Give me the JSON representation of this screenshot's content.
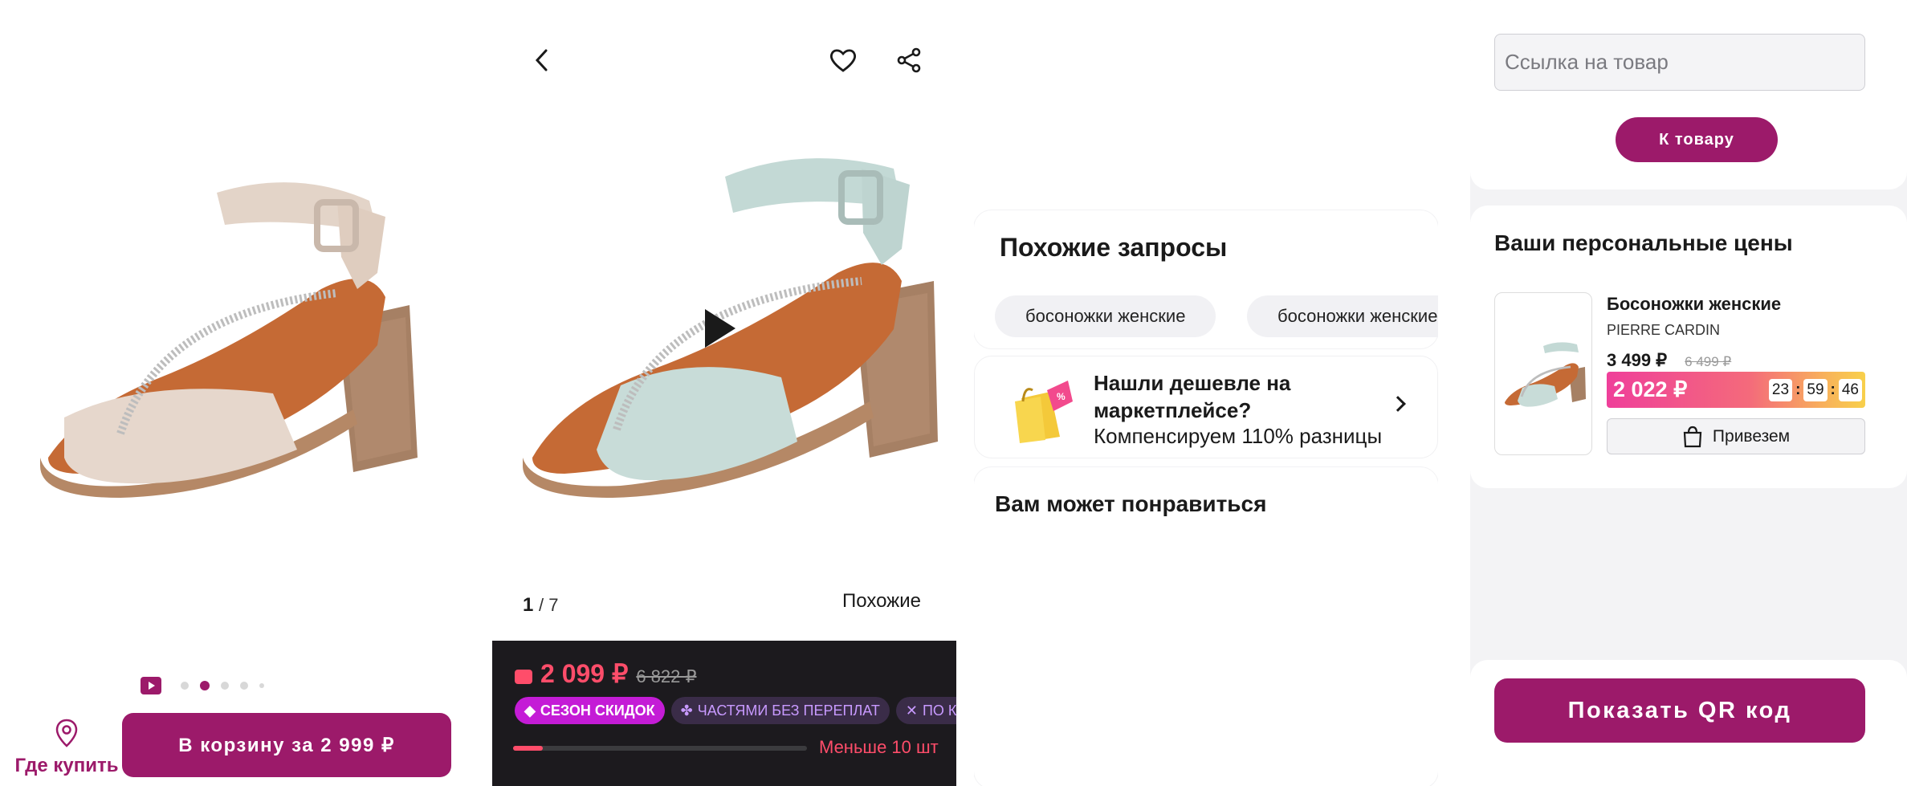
{
  "panel1": {
    "gallery": {
      "total_dots": 5,
      "active_dot": 2
    },
    "where_to_buy_label": "Где купить",
    "cart_button_label": "В корзину за 2 999 ₽"
  },
  "panel2": {
    "counter": {
      "current": "1",
      "total": "/ 7"
    },
    "similar_label": "Похожие",
    "price": "2 099 ₽",
    "old_price": "6 822 ₽",
    "badges": [
      "СЕЗОН СКИДОК",
      "ЧАСТЯМИ БЕЗ ПЕРЕПЛАТ",
      "ПО КЛ"
    ],
    "stock_text": "Меньше 10 шт",
    "stock_level": 0.1
  },
  "panel3": {
    "similar_queries_title": "Похожие запросы",
    "chips": [
      "босоножки женские",
      "босоножки женские"
    ],
    "cheaper": {
      "title": "Нашли дешевле на маркетплейсе?",
      "subtitle": "Компенсируем 110% разницы"
    },
    "recommend_title": "Вам может понравиться"
  },
  "panel4": {
    "link_placeholder": "Ссылка на товар",
    "to_product_label": "К товару",
    "personal_prices_title": "Ваши персональные цены",
    "product": {
      "name": "Босоножки женские",
      "brand": "PIERRE CARDIN",
      "price": "3 499 ₽",
      "old_price": "6 499 ₽",
      "promo_price": "2 022 ₽",
      "timer": [
        "23",
        "59",
        "46"
      ]
    },
    "deliver_label": "Привезем",
    "qr_label": "Показать QR код"
  },
  "colors": {
    "brand": "#9c1a6a",
    "sale": "#ff4d6a",
    "badge_pink": "#c41cd6"
  }
}
